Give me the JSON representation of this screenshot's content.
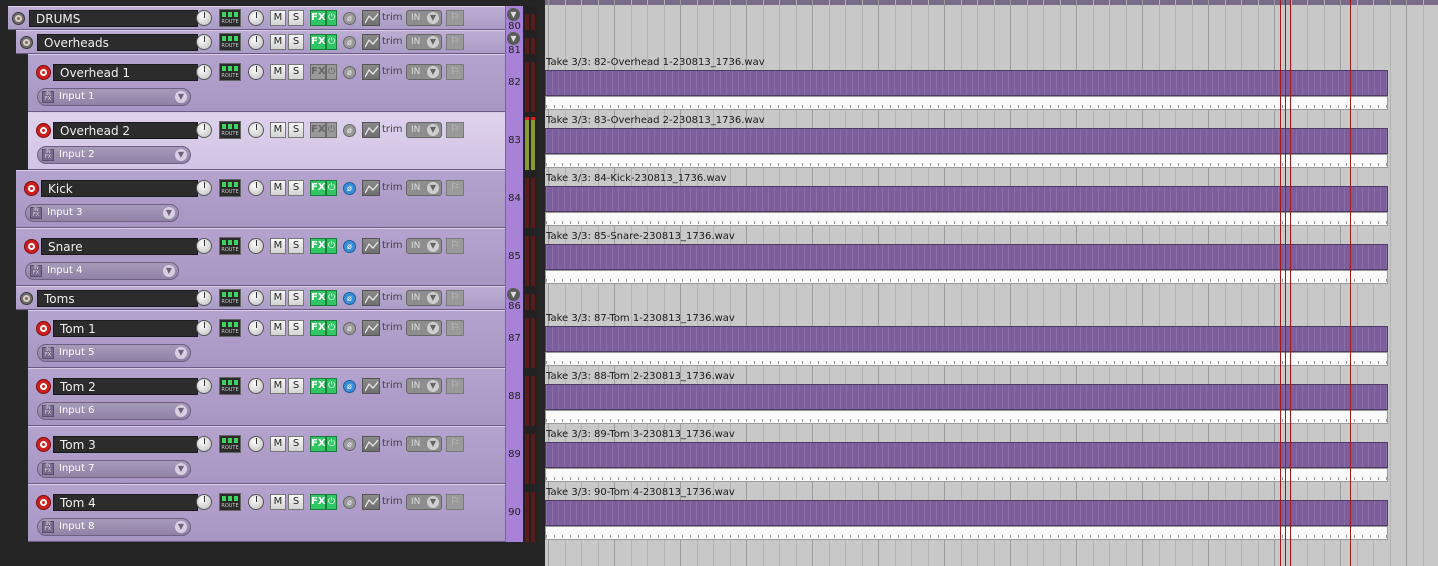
{
  "tracks": [
    {
      "id": "drums",
      "name": "DRUMS",
      "kind": "folder",
      "number": "80",
      "fx_active": true,
      "phase_active": false
    },
    {
      "id": "overheads",
      "name": "Overheads",
      "kind": "folder",
      "number": "81",
      "fx_active": true,
      "phase_active": false
    },
    {
      "id": "overhead1",
      "name": "Overhead 1",
      "kind": "track",
      "number": "82",
      "input": "Input 1",
      "fx_active": false,
      "phase_active": false,
      "item": "Take 3/3: 82-Overhead 1-230813_1736.wav"
    },
    {
      "id": "overhead2",
      "name": "Overhead 2",
      "kind": "track",
      "number": "83",
      "input": "Input 2",
      "fx_active": false,
      "phase_active": false,
      "selected": true,
      "item": "Take 3/3: 83-Overhead 2-230813_1736.wav"
    },
    {
      "id": "kick",
      "name": "Kick",
      "kind": "track",
      "number": "84",
      "input": "Input 3",
      "fx_active": true,
      "phase_active": true,
      "item": "Take 3/3: 84-Kick-230813_1736.wav"
    },
    {
      "id": "snare",
      "name": "Snare",
      "kind": "track",
      "number": "85",
      "input": "Input 4",
      "fx_active": true,
      "phase_active": true,
      "item": "Take 3/3: 85-Snare-230813_1736.wav"
    },
    {
      "id": "toms",
      "name": "Toms",
      "kind": "folder",
      "number": "86",
      "fx_active": true,
      "phase_active": true
    },
    {
      "id": "tom1",
      "name": "Tom 1",
      "kind": "track",
      "number": "87",
      "input": "Input 5",
      "fx_active": true,
      "phase_active": false,
      "item": "Take 3/3: 87-Tom 1-230813_1736.wav"
    },
    {
      "id": "tom2",
      "name": "Tom 2",
      "kind": "track",
      "number": "88",
      "input": "Input 6",
      "fx_active": true,
      "phase_active": true,
      "item": "Take 3/3: 88-Tom 2-230813_1736.wav"
    },
    {
      "id": "tom3",
      "name": "Tom 3",
      "kind": "track",
      "number": "89",
      "input": "Input 7",
      "fx_active": true,
      "phase_active": false,
      "item": "Take 3/3: 89-Tom 3-230813_1736.wav"
    },
    {
      "id": "tom4",
      "name": "Tom 4",
      "kind": "track",
      "number": "90",
      "input": "Input 8",
      "fx_active": true,
      "phase_active": false,
      "item": "Take 3/3: 90-Tom 4-230813_1736.wav"
    }
  ],
  "labels": {
    "route": "ROUTE",
    "mute": "M",
    "solo": "S",
    "fx": "FX",
    "trim": "trim",
    "input_monitor": "IN",
    "input_icon": "IN FX"
  },
  "colors": {
    "track_purple": "#a795c3",
    "track_selected": "#d1c4e5",
    "number_bg": "#a882d6",
    "fx_on": "#31c664",
    "phase_on": "#3a8fd8",
    "record_arm": "#d01f1f",
    "item_wave": "#7d5e9c",
    "edit_cursor": "#a21a1a"
  },
  "icons": {
    "record_arm": "record-arm-icon",
    "folder": "folder-icon",
    "volume_knob": "volume-knob-icon",
    "pan_knob": "pan-knob-icon",
    "phase": "phase-invert-icon",
    "envelope": "envelope-icon",
    "chevron": "chevron-down-icon",
    "flag": "flag-icon"
  }
}
